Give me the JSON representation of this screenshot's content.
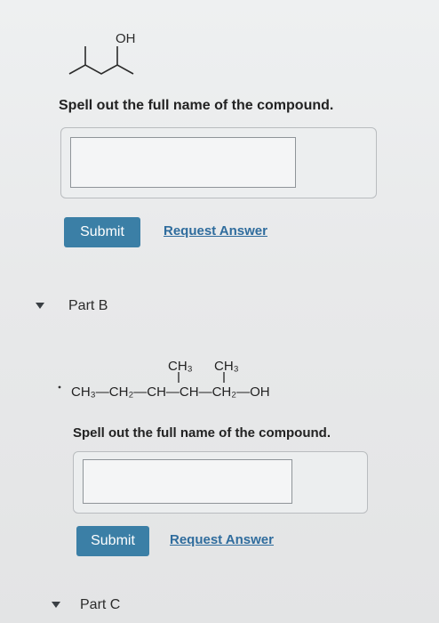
{
  "part_a": {
    "structure_label": "OH",
    "question": "Spell out the full name of the compound.",
    "answer_value": "",
    "submit_label": "Submit",
    "request_label": "Request Answer"
  },
  "part_b": {
    "label": "Part B",
    "formula": {
      "substituent_1": "CH₃",
      "substituent_2": "CH₃",
      "main_chain": "CH₃—CH₂—CH—CH—CH₂—OH"
    },
    "question": "Spell out the full name of the compound.",
    "answer_value": "",
    "submit_label": "Submit",
    "request_label": "Request Answer"
  },
  "part_c": {
    "label": "Part C"
  },
  "colors": {
    "button": "#3b7fa6",
    "link": "#2f6c9d"
  }
}
